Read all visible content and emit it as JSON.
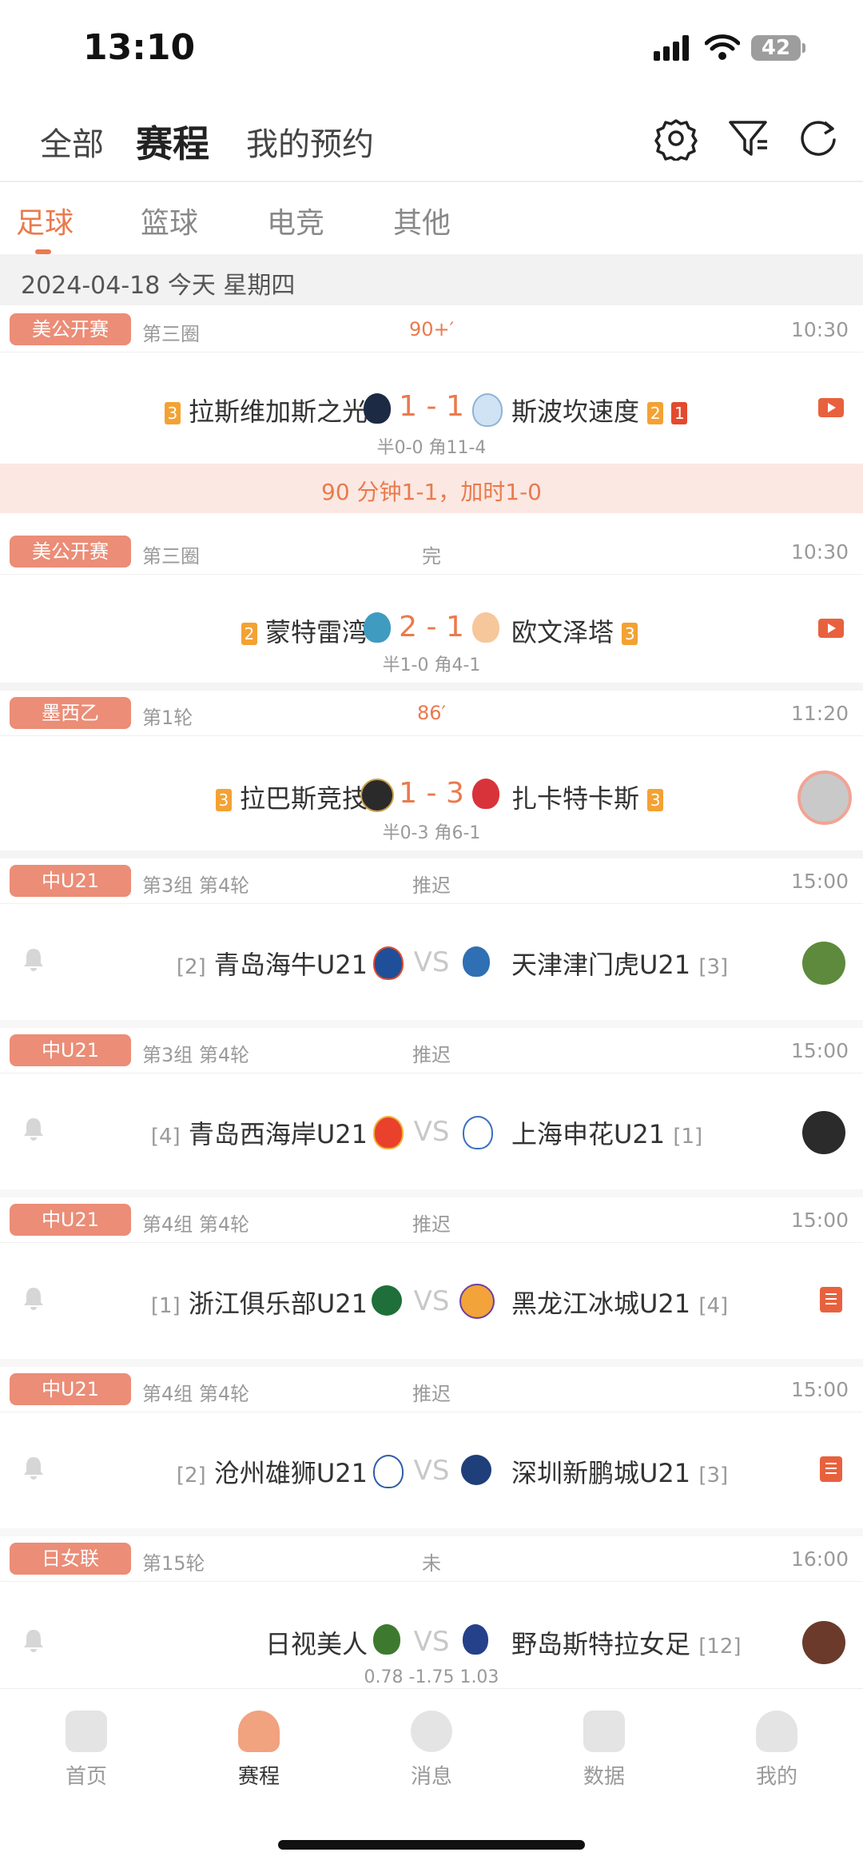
{
  "status_bar": {
    "time": "13:10",
    "battery": "42"
  },
  "header": {
    "tabs": [
      "全部",
      "赛程",
      "我的预约"
    ],
    "active_tab": "赛程",
    "icons": [
      "settings-gear-icon",
      "filter-icon",
      "refresh-icon"
    ]
  },
  "sport_tabs": [
    "足球",
    "篮球",
    "电竞",
    "其他"
  ],
  "date_bar": "2024-04-18 今天 星期四",
  "colors": {
    "accent": "#ea7a4d",
    "badge": "#eb8d77",
    "note_bg": "#fbe8e2"
  },
  "matches": [
    {
      "league": "美公开赛",
      "round": "第三圈",
      "status": "90+′",
      "time": "10:30",
      "home": "拉斯维加斯之光",
      "home_card": "3",
      "away": "斯波坎速度",
      "away_card_y": "2",
      "away_card_r": "1",
      "score": "1 - 1",
      "sub": "半0-0 角11-4",
      "note": "90 分钟1-1，加时1-0",
      "right_icon": "video-play-icon"
    },
    {
      "league": "美公开赛",
      "round": "第三圈",
      "status": "完",
      "time": "10:30",
      "home": "蒙特雷湾",
      "home_card": "2",
      "away": "欧文泽塔",
      "away_card": "3",
      "score": "2 - 1",
      "sub": "半1-0 角4-1",
      "right_icon": "video-play-icon"
    },
    {
      "league": "墨西乙",
      "round": "第1轮",
      "status": "86′",
      "time": "11:20",
      "home": "拉巴斯竞技",
      "home_card": "3",
      "away": "扎卡特卡斯",
      "away_card": "3",
      "score": "1 - 3",
      "sub": "半0-3 角6-1",
      "right_icon": "streamer-avatar"
    },
    {
      "league": "中U21",
      "round": "第3组 第4轮",
      "status": "推迟",
      "time": "15:00",
      "home_rank": "[2]",
      "home": "青岛海牛U21",
      "away": "天津津门虎U21",
      "away_rank": "[3]",
      "vs": "VS"
    },
    {
      "league": "中U21",
      "round": "第3组 第4轮",
      "status": "推迟",
      "time": "15:00",
      "home_rank": "[4]",
      "home": "青岛西海岸U21",
      "away": "上海申花U21",
      "away_rank": "[1]",
      "vs": "VS"
    },
    {
      "league": "中U21",
      "round": "第4组 第4轮",
      "status": "推迟",
      "time": "15:00",
      "home_rank": "[1]",
      "home": "浙江俱乐部U21",
      "away": "黑龙江冰城U21",
      "away_rank": "[4]",
      "vs": "VS"
    },
    {
      "league": "中U21",
      "round": "第4组 第4轮",
      "status": "推迟",
      "time": "15:00",
      "home_rank": "[2]",
      "home": "沧州雄狮U21",
      "away": "深圳新鹏城U21",
      "away_rank": "[3]",
      "vs": "VS"
    },
    {
      "league": "日女联",
      "round": "第15轮",
      "status": "未",
      "time": "16:00",
      "home": "日视美人",
      "away": "野岛斯特拉女足",
      "away_rank": "[12]",
      "vs": "VS",
      "odds": "0.78  -1.75  1.03"
    }
  ],
  "bottom_nav": [
    {
      "label": "首页",
      "icon": "home-icon"
    },
    {
      "label": "赛程",
      "icon": "trophy-icon"
    },
    {
      "label": "消息",
      "icon": "message-icon"
    },
    {
      "label": "数据",
      "icon": "chart-icon"
    },
    {
      "label": "我的",
      "icon": "profile-icon"
    }
  ]
}
